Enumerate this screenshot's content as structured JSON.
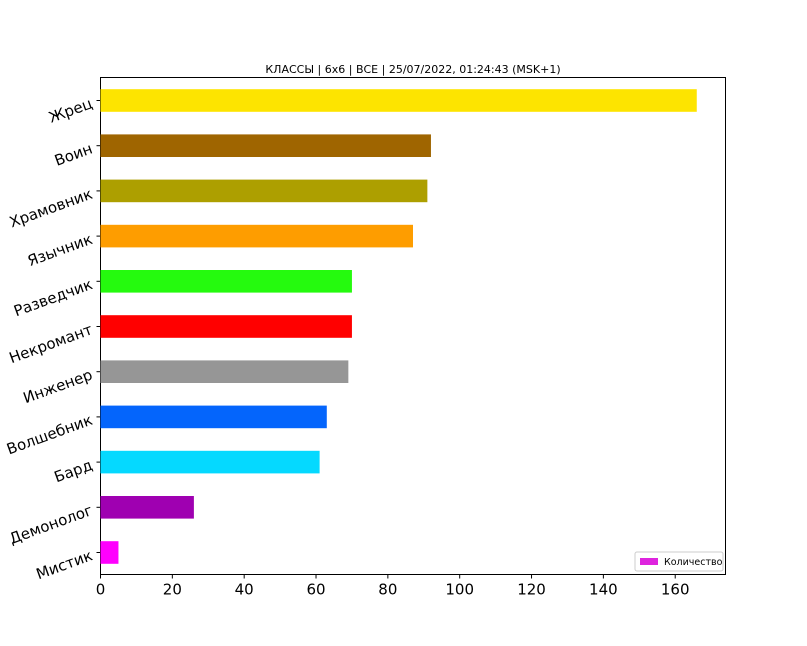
{
  "chart_data": {
    "type": "bar",
    "orientation": "horizontal",
    "title": "КЛАССЫ | 6x6 | ВСЕ | 25/07/2022, 01:24:43 (MSK+1)",
    "xlabel": "",
    "ylabel": "",
    "xlim": [
      0,
      174
    ],
    "xticks": [
      "0",
      "20",
      "40",
      "60",
      "80",
      "100",
      "120",
      "140",
      "160"
    ],
    "categories": [
      "Жрец",
      "Воин",
      "Храмовник",
      "Язычник",
      "Разведчик",
      "Некромант",
      "Инженер",
      "Волшебник",
      "Бард",
      "Демонолог",
      "Мистик"
    ],
    "series": [
      {
        "name": "Количество",
        "values": [
          166,
          92,
          91,
          87,
          70,
          70,
          69,
          63,
          61,
          26,
          5
        ],
        "colors": [
          "#fde400",
          "#9f6500",
          "#ad9f00",
          "#fe9d00",
          "#25fa0e",
          "#ff0000",
          "#969696",
          "#0465fc",
          "#05d9ff",
          "#9f00b1",
          "#ff00fe"
        ]
      }
    ],
    "legend_position": "lower-right",
    "legend_color": "#de24de",
    "grid": false
  }
}
